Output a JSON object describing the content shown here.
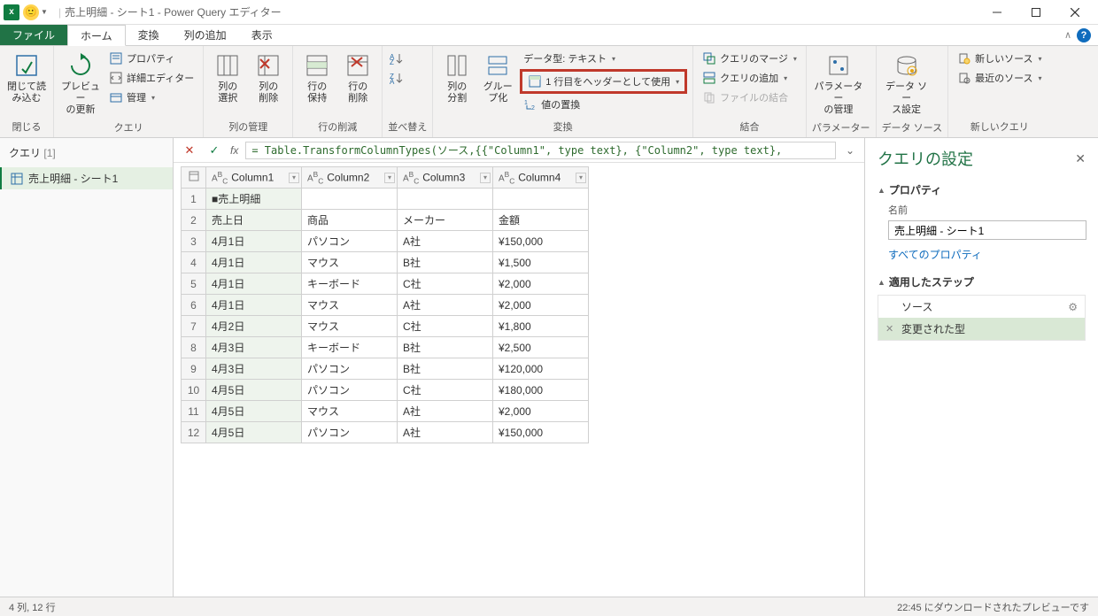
{
  "titlebar": {
    "query_name": "売上明細 - シート1",
    "app": "Power Query エディター",
    "excel_glyph": "x"
  },
  "tabs": {
    "file": "ファイル",
    "home": "ホーム",
    "transform": "変換",
    "addcolumn": "列の追加",
    "view": "表示"
  },
  "ribbon": {
    "close_load": "閉じて読\nみ込む",
    "close_group": "閉じる",
    "refresh": "プレビュー\nの更新",
    "properties": "プロパティ",
    "advanced": "詳細エディター",
    "manage": "管理",
    "query_group": "クエリ",
    "choose_cols": "列の\n選択",
    "remove_cols": "列の\n削除",
    "cols_group": "列の管理",
    "keep_rows": "行の\n保持",
    "remove_rows": "行の\n削除",
    "rows_group": "行の削減",
    "sort_group": "並べ替え",
    "split": "列の\n分割",
    "groupby": "グルー\nプ化",
    "datatype": "データ型: テキスト",
    "first_row_header": "1 行目をヘッダーとして使用",
    "replace": "値の置換",
    "transform_group": "変換",
    "merge": "クエリのマージ",
    "append": "クエリの追加",
    "combine_files": "ファイルの結合",
    "combine_group": "結合",
    "params": "パラメーター\nの管理",
    "params_group": "パラメーター",
    "datasource": "データ ソー\nス設定",
    "datasource_group": "データ ソース",
    "new_source": "新しいソース",
    "recent_source": "最近のソース",
    "newquery_group": "新しいクエリ"
  },
  "queries_panel": {
    "header": "クエリ",
    "count": "[1]",
    "item": "売上明細 - シート1"
  },
  "formula": "= Table.TransformColumnTypes(ソース,{{\"Column1\", type text}, {\"Column2\", type text},",
  "columns": [
    "Column1",
    "Column2",
    "Column3",
    "Column4"
  ],
  "rows": [
    [
      "■売上明細",
      "",
      "",
      ""
    ],
    [
      "売上日",
      "商品",
      "メーカー",
      "金額"
    ],
    [
      "4月1日",
      "パソコン",
      "A社",
      "¥150,000"
    ],
    [
      "4月1日",
      "マウス",
      "B社",
      "¥1,500"
    ],
    [
      "4月1日",
      "キーボード",
      "C社",
      "¥2,000"
    ],
    [
      "4月1日",
      "マウス",
      "A社",
      "¥2,000"
    ],
    [
      "4月2日",
      "マウス",
      "C社",
      "¥1,800"
    ],
    [
      "4月3日",
      "キーボード",
      "B社",
      "¥2,500"
    ],
    [
      "4月3日",
      "パソコン",
      "B社",
      "¥120,000"
    ],
    [
      "4月5日",
      "パソコン",
      "C社",
      "¥180,000"
    ],
    [
      "4月5日",
      "マウス",
      "A社",
      "¥2,000"
    ],
    [
      "4月5日",
      "パソコン",
      "A社",
      "¥150,000"
    ]
  ],
  "settings": {
    "title": "クエリの設定",
    "props_head": "プロパティ",
    "name_label": "名前",
    "name_value": "売上明細 - シート1",
    "all_props": "すべてのプロパティ",
    "steps_head": "適用したステップ",
    "step1": "ソース",
    "step2": "変更された型"
  },
  "status": {
    "left": "4 列, 12 行",
    "right": "22:45 にダウンロードされたプレビューです"
  }
}
